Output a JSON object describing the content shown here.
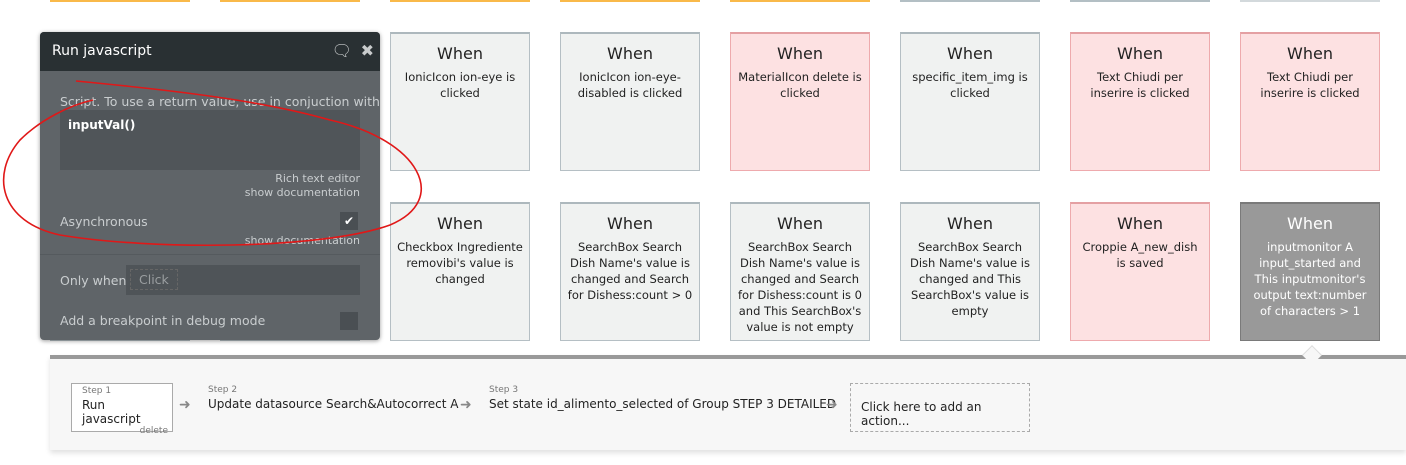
{
  "top_strip_colors": [
    "#f9b94a",
    "#f9b94a",
    "#f9b94a",
    "#f9b94a",
    "#f9b94a",
    "#b3bfc4",
    "#b3bfc4",
    "#d3d9dc"
  ],
  "when_label": "When",
  "row1": [
    {
      "text": "IonicIcon ion-eye is clicked",
      "style": "gray"
    },
    {
      "text": "IonicIcon ion-eye-disabled is clicked",
      "style": "gray"
    },
    {
      "text": "MaterialIcon delete is clicked",
      "style": "pink"
    },
    {
      "text": "specific_item_img is clicked",
      "style": "gray"
    },
    {
      "text": "Text Chiudi per inserire is clicked",
      "style": "pink"
    },
    {
      "text": "Text Chiudi per inserire is clicked",
      "style": "pink"
    }
  ],
  "row2": [
    {
      "text": "Checkbox Ingrediente removibi's value is changed",
      "style": "gray"
    },
    {
      "text": "SearchBox Search Dish Name's value is changed and Search for Dishess:count > 0",
      "style": "gray"
    },
    {
      "text": "SearchBox Search Dish Name's value is changed and Search for Dishess:count is 0 and This SearchBox's value is not empty",
      "style": "gray"
    },
    {
      "text": "SearchBox Search Dish Name's value is changed and This SearchBox's value is empty",
      "style": "gray"
    },
    {
      "text": "Croppie A_new_dish is saved",
      "style": "pink"
    },
    {
      "text": "inputmonitor A input_started and This inputmonitor's output text:number of characters > 1",
      "style": "sel"
    }
  ],
  "panel": {
    "title": "Run javascript",
    "script_label": "Script. To use a return value, use in conjuction with",
    "script_value": "inputVal()",
    "rich_text": "Rich text editor",
    "show_doc": "show documentation",
    "async_label": "Asynchronous",
    "async_checked": true,
    "show_doc2": "show documentation",
    "only_when": "Only when",
    "click_placeholder": "Click",
    "breakpoint": "Add a breakpoint in debug mode",
    "breakpoint_checked": false
  },
  "workflow": {
    "steps": [
      {
        "num": "Step 1",
        "label": "Run javascript",
        "delete": "delete"
      },
      {
        "num": "Step 2",
        "label": "Update datasource Search&Autocorrect A"
      },
      {
        "num": "Step 3",
        "label": "Set state id_alimento_selected of Group STEP 3 DETAILED"
      }
    ],
    "add_action": "Click here to add an action..."
  }
}
